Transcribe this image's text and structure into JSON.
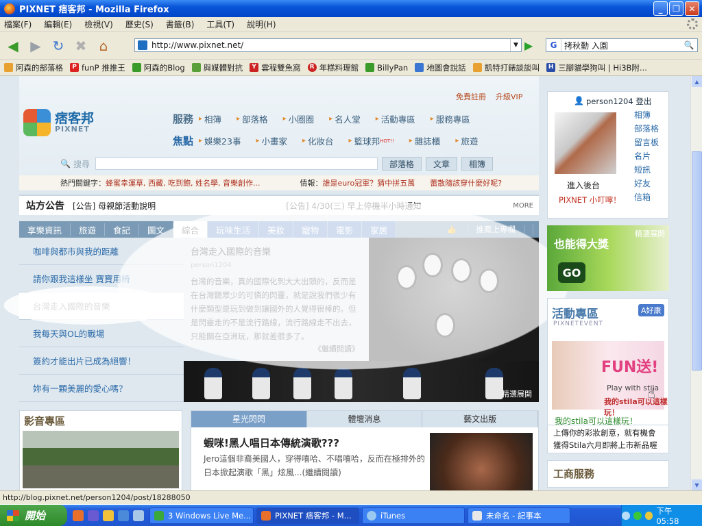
{
  "window": {
    "title": "PIXNET 痞客邦 - Mozilla Firefox"
  },
  "menu": [
    "檔案(F)",
    "編輯(E)",
    "檢視(V)",
    "歷史(S)",
    "書籤(B)",
    "工具(T)",
    "說明(H)"
  ],
  "nav": {
    "url": "http://www.pixnet.net/",
    "search_value": "拷秋勤 入園"
  },
  "bookmarks": [
    "阿森的部落格",
    "funP 推推王",
    "阿森的Blog",
    "與媒體對抗",
    "雲程雙魚窩",
    "年糕料理館",
    "BillyPan",
    "地圖會說話",
    "凱特打錶談談叫",
    "三腳貓學狗叫 | Hi3B附..."
  ],
  "site": {
    "logo_cn": "痞客邦",
    "logo_en": "PIXNET",
    "register": "免費註冊",
    "upgrade": "升級VIP",
    "service_label": "服務",
    "services": [
      "相簿",
      "部落格",
      "小圈圈",
      "名人堂",
      "活動專區",
      "服務專區"
    ],
    "focus_label": "焦點",
    "focus": [
      "娛樂23事",
      "小畫家",
      "化妝台",
      "籃球邦",
      "雜誌櫃",
      "旅遊"
    ],
    "hot_badge": "HOT!!",
    "search_label": "搜尋",
    "search_btns": [
      "部落格",
      "文章",
      "相簿"
    ],
    "hot_prefix": "熱門關鍵字：",
    "hot_words": "蜂蜜幸運草, 西藏, 吃到飽, 姓名學, 音樂創作...",
    "info_prefix": "情報：",
    "info_text": "誰是euro冠軍？猜中拼五萬　　蕾散隨該穿什麼好呢?",
    "announce_title": "站方公告",
    "announce_1": "[公告] 母親節活動說明",
    "announce_2": "[公告] 4/30(三) 早上停機半小時通知",
    "more": "MORE",
    "tabs": [
      "享樂資訊",
      "旅遊",
      "食記",
      "圖文",
      "綜合",
      "玩味生活",
      "美妝",
      "寵物",
      "電影",
      "家居"
    ],
    "pin": "推薦上專欄",
    "left_list": [
      "咖啡與都市與我的距離",
      "請你跟我這樣坐 寶寶用椅",
      "台灣走入國際的音樂",
      "我每天與OL的戰場",
      "簽約才能出片已成為絕響！",
      "妳有一顆美麗的愛心嗎？"
    ],
    "article": {
      "title": "台灣走入國際的音樂",
      "author": "person1204",
      "body": "台灣的音樂，真的國際化到大大出頭的，反而是在台灣聽眾少的可憐的閃靈，就是說我們很少有什麼類型是玩到做到讓國外的人覺得很棒的。但是閃靈走的不是流行路線，流行路線走不出去，只能關在亞洲玩，那就差很多了。",
      "readmore": "《繼續閱讀》"
    },
    "strip_caption": "精選展開",
    "video_title": "影音專區",
    "ent_tabs": [
      "星光閃閃",
      "體壇消息",
      "藝文出版"
    ],
    "ent_title": "蝦咪!黑人唱日本傳統演歌???",
    "ent_body": "Jero這個非裔美國人，穿得嘻哈、不唱嘻哈，反而在極排外的日本掀起演歌「黑」炫風...(繼續閱讀)",
    "user": {
      "name": "person1204",
      "logout": "登出",
      "links": [
        "相簿",
        "部落格",
        "留言板",
        "名片",
        "短訊",
        "好友",
        "信箱"
      ],
      "enter": "進入後台",
      "tip": "PIXNET 小叮嚀！"
    },
    "ad1_text": "也能得大獎",
    "ad1_go": "GO",
    "ad1_badge": "精選展開",
    "event_title": "活動專區",
    "event_en": "PIXNETEVENT",
    "event_badge": "A好康",
    "event_fun": "FUN送!",
    "event_play": "Play with stila",
    "event_stila": "我的stila可以這樣玩！",
    "event_caption": "我的stila可以這樣玩！",
    "event_desc": "上傳你的彩妝創意，就有機會獲得Stila六月即將上市新品喔",
    "biz_title": "工商服務"
  },
  "status": "http://blog.pixnet.net/person1204/post/18288050",
  "taskbar": {
    "start": "開始",
    "tasks": [
      "3 Windows Live Me...",
      "PIXNET 痞客邦 - M...",
      "iTunes",
      "未命名 - 記事本"
    ],
    "clock": "下午 05:58"
  }
}
